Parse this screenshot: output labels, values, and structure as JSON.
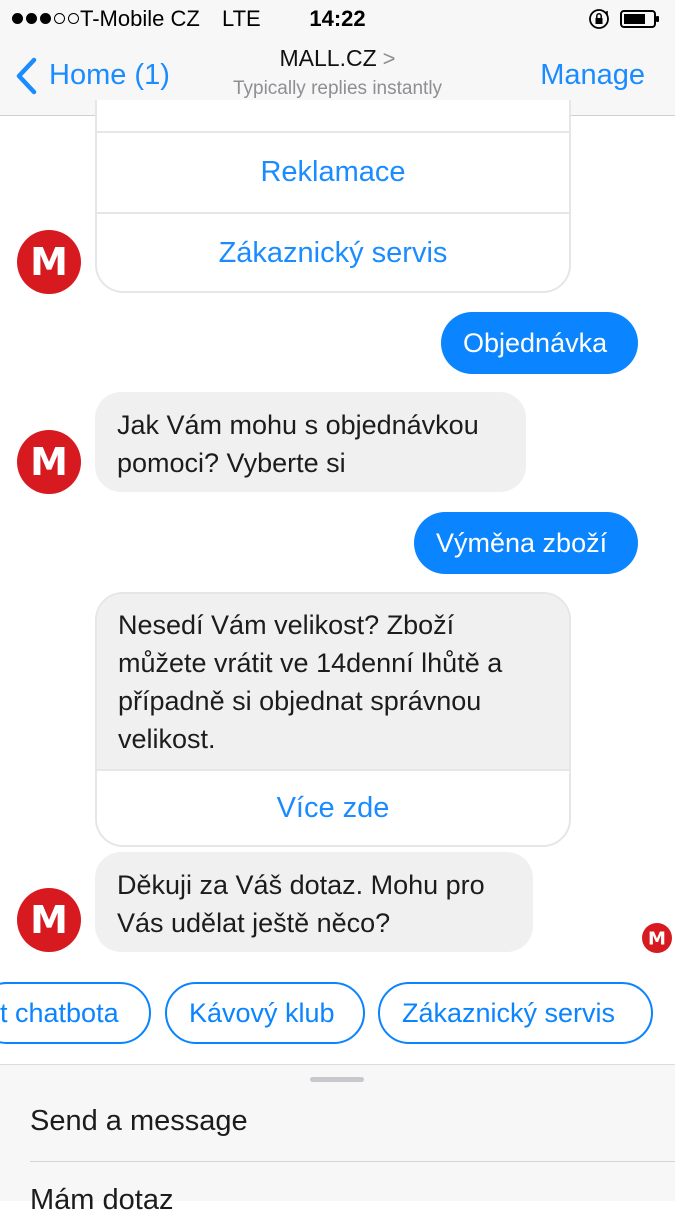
{
  "status_bar": {
    "carrier": "T-Mobile CZ",
    "network": "LTE",
    "time": "14:22",
    "signal_icon": "signal-dots-icon",
    "lock_icon": "orientation-lock-icon",
    "battery_icon": "battery-icon"
  },
  "nav": {
    "back_label": "Home (1)",
    "title": "MALL.CZ",
    "title_chevron": ">",
    "subtitle": "Typically replies instantly",
    "manage_label": "Manage"
  },
  "colors": {
    "accent": "#1a8cff",
    "bubble_out": "#0a84ff",
    "bubble_in": "#f0f0f0",
    "brand_red": "#d71920"
  },
  "messages": {
    "card1_btn1": "Reklamace",
    "card1_btn2": "Zákaznický servis",
    "out1": "Objednávka",
    "in1_line1": "Jak Vám mohu s objednávkou",
    "in1_line2": "pomoci? Vyberte si",
    "out2": "Výměna zboží",
    "card2_line1": "Nesedí Vám velikost? Zboží",
    "card2_line2": "můžete vrátit ve 14denní lhůtě a",
    "card2_line3": "případně si objednat správnou",
    "card2_line4": "velikost.",
    "card2_btn": "Více zde",
    "in2_line1": "Děkuji za Váš dotaz. Mohu pro",
    "in2_line2": "Vás udělat ještě něco?",
    "avatar_letter": "M"
  },
  "quick_replies": [
    "t chatbota",
    "Kávový klub",
    "Zákaznický servis"
  ],
  "composer": {
    "items": [
      "Send a message",
      "Mám dotaz"
    ]
  }
}
